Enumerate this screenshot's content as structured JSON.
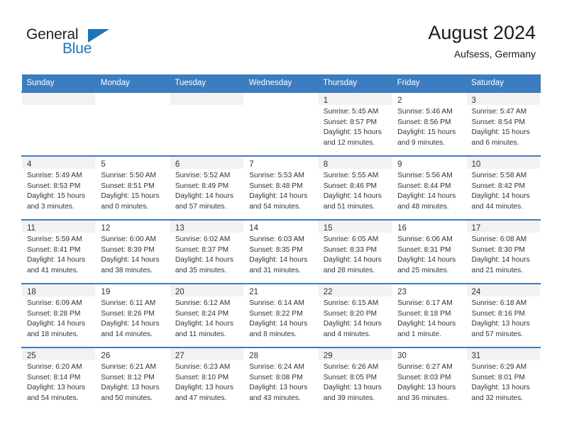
{
  "brand": {
    "name_part1": "General",
    "name_part2": "Blue",
    "triangle_icon": "blue-triangle-icon",
    "colors": {
      "dark": "#231f20",
      "blue": "#1b75bb"
    }
  },
  "header": {
    "title": "August 2024",
    "subtitle": "Aufsess, Germany"
  },
  "theme": {
    "header_row_bg": "#3b7dc0",
    "row_divider": "#3b7dc0",
    "shaded_cell_bg": "#f2f2f2",
    "text": "#333333"
  },
  "weekday_headers": [
    "Sunday",
    "Monday",
    "Tuesday",
    "Wednesday",
    "Thursday",
    "Friday",
    "Saturday"
  ],
  "weeks": [
    [
      {
        "day": "",
        "sunrise": "",
        "sunset": "",
        "daylight1": "",
        "daylight2": "",
        "empty": true,
        "shaded": true
      },
      {
        "day": "",
        "sunrise": "",
        "sunset": "",
        "daylight1": "",
        "daylight2": "",
        "empty": true,
        "shaded": false
      },
      {
        "day": "",
        "sunrise": "",
        "sunset": "",
        "daylight1": "",
        "daylight2": "",
        "empty": true,
        "shaded": true
      },
      {
        "day": "",
        "sunrise": "",
        "sunset": "",
        "daylight1": "",
        "daylight2": "",
        "empty": true,
        "shaded": false
      },
      {
        "day": "1",
        "sunrise": "Sunrise: 5:45 AM",
        "sunset": "Sunset: 8:57 PM",
        "daylight1": "Daylight: 15 hours",
        "daylight2": "and 12 minutes.",
        "empty": false,
        "shaded": true
      },
      {
        "day": "2",
        "sunrise": "Sunrise: 5:46 AM",
        "sunset": "Sunset: 8:56 PM",
        "daylight1": "Daylight: 15 hours",
        "daylight2": "and 9 minutes.",
        "empty": false,
        "shaded": false
      },
      {
        "day": "3",
        "sunrise": "Sunrise: 5:47 AM",
        "sunset": "Sunset: 8:54 PM",
        "daylight1": "Daylight: 15 hours",
        "daylight2": "and 6 minutes.",
        "empty": false,
        "shaded": true
      }
    ],
    [
      {
        "day": "4",
        "sunrise": "Sunrise: 5:49 AM",
        "sunset": "Sunset: 8:53 PM",
        "daylight1": "Daylight: 15 hours",
        "daylight2": "and 3 minutes.",
        "empty": false,
        "shaded": true
      },
      {
        "day": "5",
        "sunrise": "Sunrise: 5:50 AM",
        "sunset": "Sunset: 8:51 PM",
        "daylight1": "Daylight: 15 hours",
        "daylight2": "and 0 minutes.",
        "empty": false,
        "shaded": false
      },
      {
        "day": "6",
        "sunrise": "Sunrise: 5:52 AM",
        "sunset": "Sunset: 8:49 PM",
        "daylight1": "Daylight: 14 hours",
        "daylight2": "and 57 minutes.",
        "empty": false,
        "shaded": true
      },
      {
        "day": "7",
        "sunrise": "Sunrise: 5:53 AM",
        "sunset": "Sunset: 8:48 PM",
        "daylight1": "Daylight: 14 hours",
        "daylight2": "and 54 minutes.",
        "empty": false,
        "shaded": false
      },
      {
        "day": "8",
        "sunrise": "Sunrise: 5:55 AM",
        "sunset": "Sunset: 8:46 PM",
        "daylight1": "Daylight: 14 hours",
        "daylight2": "and 51 minutes.",
        "empty": false,
        "shaded": true
      },
      {
        "day": "9",
        "sunrise": "Sunrise: 5:56 AM",
        "sunset": "Sunset: 8:44 PM",
        "daylight1": "Daylight: 14 hours",
        "daylight2": "and 48 minutes.",
        "empty": false,
        "shaded": false
      },
      {
        "day": "10",
        "sunrise": "Sunrise: 5:58 AM",
        "sunset": "Sunset: 8:42 PM",
        "daylight1": "Daylight: 14 hours",
        "daylight2": "and 44 minutes.",
        "empty": false,
        "shaded": true
      }
    ],
    [
      {
        "day": "11",
        "sunrise": "Sunrise: 5:59 AM",
        "sunset": "Sunset: 8:41 PM",
        "daylight1": "Daylight: 14 hours",
        "daylight2": "and 41 minutes.",
        "empty": false,
        "shaded": true
      },
      {
        "day": "12",
        "sunrise": "Sunrise: 6:00 AM",
        "sunset": "Sunset: 8:39 PM",
        "daylight1": "Daylight: 14 hours",
        "daylight2": "and 38 minutes.",
        "empty": false,
        "shaded": false
      },
      {
        "day": "13",
        "sunrise": "Sunrise: 6:02 AM",
        "sunset": "Sunset: 8:37 PM",
        "daylight1": "Daylight: 14 hours",
        "daylight2": "and 35 minutes.",
        "empty": false,
        "shaded": true
      },
      {
        "day": "14",
        "sunrise": "Sunrise: 6:03 AM",
        "sunset": "Sunset: 8:35 PM",
        "daylight1": "Daylight: 14 hours",
        "daylight2": "and 31 minutes.",
        "empty": false,
        "shaded": false
      },
      {
        "day": "15",
        "sunrise": "Sunrise: 6:05 AM",
        "sunset": "Sunset: 8:33 PM",
        "daylight1": "Daylight: 14 hours",
        "daylight2": "and 28 minutes.",
        "empty": false,
        "shaded": true
      },
      {
        "day": "16",
        "sunrise": "Sunrise: 6:06 AM",
        "sunset": "Sunset: 8:31 PM",
        "daylight1": "Daylight: 14 hours",
        "daylight2": "and 25 minutes.",
        "empty": false,
        "shaded": false
      },
      {
        "day": "17",
        "sunrise": "Sunrise: 6:08 AM",
        "sunset": "Sunset: 8:30 PM",
        "daylight1": "Daylight: 14 hours",
        "daylight2": "and 21 minutes.",
        "empty": false,
        "shaded": true
      }
    ],
    [
      {
        "day": "18",
        "sunrise": "Sunrise: 6:09 AM",
        "sunset": "Sunset: 8:28 PM",
        "daylight1": "Daylight: 14 hours",
        "daylight2": "and 18 minutes.",
        "empty": false,
        "shaded": true
      },
      {
        "day": "19",
        "sunrise": "Sunrise: 6:11 AM",
        "sunset": "Sunset: 8:26 PM",
        "daylight1": "Daylight: 14 hours",
        "daylight2": "and 14 minutes.",
        "empty": false,
        "shaded": false
      },
      {
        "day": "20",
        "sunrise": "Sunrise: 6:12 AM",
        "sunset": "Sunset: 8:24 PM",
        "daylight1": "Daylight: 14 hours",
        "daylight2": "and 11 minutes.",
        "empty": false,
        "shaded": true
      },
      {
        "day": "21",
        "sunrise": "Sunrise: 6:14 AM",
        "sunset": "Sunset: 8:22 PM",
        "daylight1": "Daylight: 14 hours",
        "daylight2": "and 8 minutes.",
        "empty": false,
        "shaded": false
      },
      {
        "day": "22",
        "sunrise": "Sunrise: 6:15 AM",
        "sunset": "Sunset: 8:20 PM",
        "daylight1": "Daylight: 14 hours",
        "daylight2": "and 4 minutes.",
        "empty": false,
        "shaded": true
      },
      {
        "day": "23",
        "sunrise": "Sunrise: 6:17 AM",
        "sunset": "Sunset: 8:18 PM",
        "daylight1": "Daylight: 14 hours",
        "daylight2": "and 1 minute.",
        "empty": false,
        "shaded": false
      },
      {
        "day": "24",
        "sunrise": "Sunrise: 6:18 AM",
        "sunset": "Sunset: 8:16 PM",
        "daylight1": "Daylight: 13 hours",
        "daylight2": "and 57 minutes.",
        "empty": false,
        "shaded": true
      }
    ],
    [
      {
        "day": "25",
        "sunrise": "Sunrise: 6:20 AM",
        "sunset": "Sunset: 8:14 PM",
        "daylight1": "Daylight: 13 hours",
        "daylight2": "and 54 minutes.",
        "empty": false,
        "shaded": true
      },
      {
        "day": "26",
        "sunrise": "Sunrise: 6:21 AM",
        "sunset": "Sunset: 8:12 PM",
        "daylight1": "Daylight: 13 hours",
        "daylight2": "and 50 minutes.",
        "empty": false,
        "shaded": false
      },
      {
        "day": "27",
        "sunrise": "Sunrise: 6:23 AM",
        "sunset": "Sunset: 8:10 PM",
        "daylight1": "Daylight: 13 hours",
        "daylight2": "and 47 minutes.",
        "empty": false,
        "shaded": true
      },
      {
        "day": "28",
        "sunrise": "Sunrise: 6:24 AM",
        "sunset": "Sunset: 8:08 PM",
        "daylight1": "Daylight: 13 hours",
        "daylight2": "and 43 minutes.",
        "empty": false,
        "shaded": false
      },
      {
        "day": "29",
        "sunrise": "Sunrise: 6:26 AM",
        "sunset": "Sunset: 8:05 PM",
        "daylight1": "Daylight: 13 hours",
        "daylight2": "and 39 minutes.",
        "empty": false,
        "shaded": true
      },
      {
        "day": "30",
        "sunrise": "Sunrise: 6:27 AM",
        "sunset": "Sunset: 8:03 PM",
        "daylight1": "Daylight: 13 hours",
        "daylight2": "and 36 minutes.",
        "empty": false,
        "shaded": false
      },
      {
        "day": "31",
        "sunrise": "Sunrise: 6:29 AM",
        "sunset": "Sunset: 8:01 PM",
        "daylight1": "Daylight: 13 hours",
        "daylight2": "and 32 minutes.",
        "empty": false,
        "shaded": true
      }
    ]
  ]
}
